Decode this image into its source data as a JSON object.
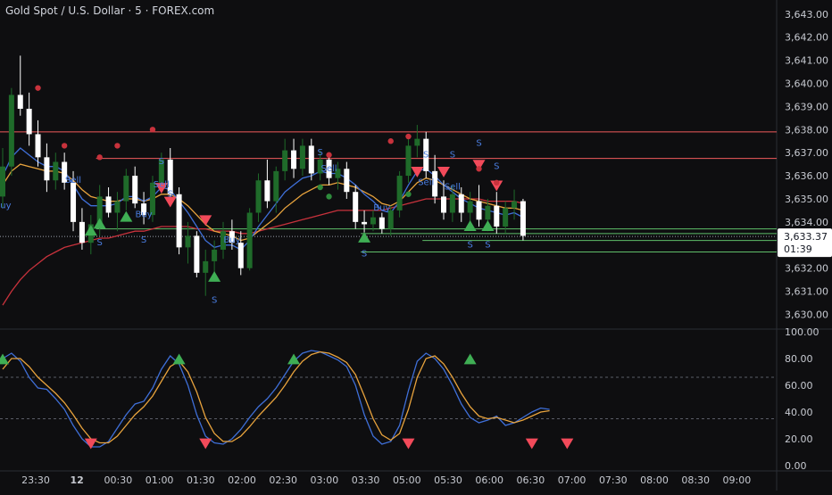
{
  "header": {
    "title": "Gold Spot / U.S. Dollar · 5 · FOREX.com"
  },
  "colors": {
    "background": "#0e0e10",
    "bull": "#1f6b2a",
    "bear": "#ffffff",
    "ma_slow": "#c8323c",
    "ma_fast": "#e8a33d",
    "ma_blue": "#3f6fd8",
    "level_red": "#f15b5b",
    "level_green": "#5fbf6a",
    "signal_buy": "#3fae54",
    "signal_sell": "#f24a5a",
    "stoch_k": "#3f6fd8",
    "stoch_d": "#e8a33d"
  },
  "price_axis": {
    "labels": [
      "3,643.00",
      "3,642.00",
      "3,641.00",
      "3,640.00",
      "3,639.00",
      "3,638.00",
      "3,637.00",
      "3,636.00",
      "3,635.00",
      "3,634.00",
      "3,632.00",
      "3,631.00",
      "3,630.00"
    ],
    "current_price": "3,633.37",
    "countdown": "01:39"
  },
  "time_axis": {
    "labels": [
      "23:30",
      "12",
      "00:30",
      "01:00",
      "01:30",
      "02:00",
      "02:30",
      "03:00",
      "03:30",
      "05:00",
      "05:30",
      "06:00",
      "06:30",
      "07:00",
      "07:30",
      "08:00",
      "08:30",
      "09:00"
    ]
  },
  "chart_data": [
    {
      "type": "candlestick",
      "title": "Gold Spot / U.S. Dollar · 5 · FOREX.com",
      "ylim": [
        3629.4,
        3643.3
      ],
      "current_price": 3633.37,
      "candles": [
        [
          3635.1,
          3637.2,
          3634.6,
          3636.4
        ],
        [
          3636.4,
          3639.8,
          3636.0,
          3639.5
        ],
        [
          3639.5,
          3641.2,
          3638.6,
          3638.9
        ],
        [
          3638.9,
          3639.6,
          3637.3,
          3637.8
        ],
        [
          3637.8,
          3638.4,
          3636.4,
          3636.8
        ],
        [
          3636.8,
          3637.4,
          3635.3,
          3635.8
        ],
        [
          3635.8,
          3637.0,
          3635.4,
          3636.6
        ],
        [
          3636.6,
          3637.0,
          3635.4,
          3635.7
        ],
        [
          3635.7,
          3636.2,
          3633.6,
          3634.0
        ],
        [
          3634.0,
          3634.6,
          3632.8,
          3633.1
        ],
        [
          3633.1,
          3634.3,
          3632.6,
          3633.9
        ],
        [
          3633.9,
          3635.6,
          3633.4,
          3635.1
        ],
        [
          3635.1,
          3635.5,
          3634.2,
          3634.4
        ],
        [
          3634.4,
          3635.3,
          3633.6,
          3634.9
        ],
        [
          3634.9,
          3636.3,
          3634.5,
          3636.0
        ],
        [
          3636.0,
          3636.4,
          3634.6,
          3634.8
        ],
        [
          3634.8,
          3635.3,
          3633.9,
          3634.3
        ],
        [
          3634.3,
          3636.0,
          3634.0,
          3635.7
        ],
        [
          3635.7,
          3637.0,
          3635.3,
          3636.7
        ],
        [
          3636.7,
          3637.2,
          3634.9,
          3635.2
        ],
        [
          3635.2,
          3635.5,
          3632.6,
          3632.9
        ],
        [
          3632.9,
          3634.0,
          3632.2,
          3633.4
        ],
        [
          3633.4,
          3633.6,
          3631.6,
          3631.8
        ],
        [
          3631.8,
          3632.8,
          3630.8,
          3632.3
        ],
        [
          3632.3,
          3633.2,
          3631.7,
          3632.8
        ],
        [
          3632.8,
          3634.0,
          3632.4,
          3633.6
        ],
        [
          3633.6,
          3634.1,
          3632.8,
          3633.1
        ],
        [
          3633.1,
          3633.6,
          3631.7,
          3632.0
        ],
        [
          3632.0,
          3634.6,
          3631.9,
          3634.4
        ],
        [
          3634.4,
          3636.1,
          3634.0,
          3635.8
        ],
        [
          3635.8,
          3636.7,
          3634.6,
          3634.9
        ],
        [
          3634.9,
          3636.4,
          3634.4,
          3636.2
        ],
        [
          3636.2,
          3637.6,
          3635.8,
          3637.1
        ],
        [
          3637.1,
          3637.6,
          3635.9,
          3636.3
        ],
        [
          3636.3,
          3637.6,
          3636.0,
          3637.3
        ],
        [
          3637.3,
          3637.6,
          3635.8,
          3636.1
        ],
        [
          3636.1,
          3637.1,
          3635.8,
          3636.7
        ],
        [
          3636.7,
          3636.9,
          3635.6,
          3635.9
        ],
        [
          3635.9,
          3636.6,
          3635.4,
          3636.3
        ],
        [
          3636.3,
          3636.6,
          3635.0,
          3635.3
        ],
        [
          3635.3,
          3635.6,
          3633.7,
          3634.0
        ],
        [
          3634.0,
          3634.5,
          3633.3,
          3633.9
        ],
        [
          3633.9,
          3634.5,
          3633.6,
          3634.2
        ],
        [
          3634.2,
          3634.4,
          3633.5,
          3633.7
        ],
        [
          3633.7,
          3634.7,
          3633.4,
          3634.5
        ],
        [
          3634.5,
          3636.2,
          3634.2,
          3636.0
        ],
        [
          3636.0,
          3637.6,
          3635.7,
          3637.3
        ],
        [
          3637.3,
          3638.2,
          3636.8,
          3637.6
        ],
        [
          3637.6,
          3637.9,
          3635.9,
          3636.2
        ],
        [
          3636.2,
          3636.9,
          3634.8,
          3635.1
        ],
        [
          3635.1,
          3635.8,
          3634.1,
          3634.4
        ],
        [
          3634.4,
          3635.6,
          3634.0,
          3635.2
        ],
        [
          3635.2,
          3635.5,
          3634.0,
          3634.4
        ],
        [
          3634.4,
          3635.3,
          3634.0,
          3634.9
        ],
        [
          3634.9,
          3635.6,
          3633.8,
          3634.1
        ],
        [
          3634.1,
          3635.0,
          3633.6,
          3634.7
        ],
        [
          3634.7,
          3635.3,
          3633.5,
          3633.8
        ],
        [
          3633.8,
          3634.9,
          3633.5,
          3634.6
        ],
        [
          3634.6,
          3635.4,
          3634.1,
          3634.9
        ],
        [
          3634.9,
          3635.0,
          3633.2,
          3633.4
        ]
      ],
      "moving_averages": [
        {
          "name": "",
          "color": "#c8323c",
          "values": [
            3630.4,
            3631.0,
            3631.5,
            3631.9,
            3632.2,
            3632.5,
            3632.7,
            3632.9,
            3633.0,
            3633.1,
            3633.2,
            3633.3,
            3633.3,
            3633.4,
            3633.5,
            3633.6,
            3633.6,
            3633.7,
            3633.8,
            3633.8,
            3633.8,
            3633.8,
            3633.7,
            3633.7,
            3633.6,
            3633.6,
            3633.6,
            3633.5,
            3633.5,
            3633.6,
            3633.7,
            3633.8,
            3633.9,
            3634.0,
            3634.1,
            3634.2,
            3634.3,
            3634.4,
            3634.5,
            3634.5,
            3634.5,
            3634.5,
            3634.5,
            3634.5,
            3634.6,
            3634.7,
            3634.8,
            3634.9,
            3635.0,
            3635.0,
            3635.0,
            3635.0,
            3635.0,
            3635.0,
            3635.0,
            3634.9,
            3634.9,
            3634.9,
            3634.9,
            3634.8
          ]
        },
        {
          "name": "",
          "color": "#e8a33d",
          "values": [
            3635.6,
            3636.2,
            3636.5,
            3636.4,
            3636.3,
            3636.2,
            3636.2,
            3636.1,
            3635.8,
            3635.4,
            3635.1,
            3635.0,
            3634.9,
            3634.9,
            3635.0,
            3635.0,
            3634.9,
            3635.0,
            3635.2,
            3635.2,
            3635.0,
            3634.7,
            3634.3,
            3633.9,
            3633.6,
            3633.5,
            3633.4,
            3633.2,
            3633.3,
            3633.6,
            3633.9,
            3634.2,
            3634.6,
            3634.9,
            3635.2,
            3635.4,
            3635.6,
            3635.6,
            3635.7,
            3635.6,
            3635.5,
            3635.3,
            3635.1,
            3634.8,
            3634.7,
            3634.9,
            3635.3,
            3635.7,
            3635.9,
            3635.8,
            3635.6,
            3635.4,
            3635.2,
            3635.0,
            3634.9,
            3634.8,
            3634.7,
            3634.6,
            3634.6,
            3634.5
          ]
        },
        {
          "name": "",
          "color": "#3f6fd8",
          "values": [
            3636.0,
            3636.8,
            3637.2,
            3636.9,
            3636.6,
            3636.4,
            3636.4,
            3636.2,
            3635.6,
            3635.0,
            3634.7,
            3634.7,
            3634.7,
            3634.8,
            3635.1,
            3635.1,
            3634.9,
            3635.1,
            3635.5,
            3635.4,
            3634.9,
            3634.4,
            3633.8,
            3633.2,
            3632.9,
            3633.0,
            3633.0,
            3632.8,
            3633.2,
            3633.8,
            3634.3,
            3634.8,
            3635.3,
            3635.6,
            3635.9,
            3636.0,
            3636.2,
            3636.1,
            3636.1,
            3635.9,
            3635.6,
            3635.2,
            3634.9,
            3634.5,
            3634.4,
            3634.9,
            3635.6,
            3636.2,
            3636.3,
            3636.0,
            3635.6,
            3635.3,
            3635.0,
            3634.8,
            3634.6,
            3634.5,
            3634.4,
            3634.3,
            3634.4,
            3634.2
          ]
        }
      ],
      "levels": [
        {
          "price": 3637.9,
          "color": "#f15b5b",
          "from_index": 0
        },
        {
          "price": 3636.75,
          "color": "#f15b5b",
          "from_index": 11
        },
        {
          "price": 3633.7,
          "color": "#5fbf6a",
          "from_index": 11
        },
        {
          "price": 3633.5,
          "color": "#5fbf6a",
          "from_index": 41
        },
        {
          "price": 3633.2,
          "color": "#5fbf6a",
          "from_index": 48
        },
        {
          "price": 3632.7,
          "color": "#5fbf6a",
          "from_index": 41
        }
      ],
      "signals": [
        {
          "kind": "buy-triangle",
          "index": 10,
          "price": 3633.6
        },
        {
          "kind": "buy-triangle",
          "index": 11,
          "price": 3633.9
        },
        {
          "kind": "buy-triangle",
          "index": 14,
          "price": 3634.2
        },
        {
          "kind": "buy-triangle",
          "index": 24,
          "price": 3631.6
        },
        {
          "kind": "buy-triangle",
          "index": 41,
          "price": 3633.3
        },
        {
          "kind": "buy-triangle",
          "index": 53,
          "price": 3633.8
        },
        {
          "kind": "buy-triangle",
          "index": 55,
          "price": 3633.8
        },
        {
          "kind": "sell-triangle",
          "index": 18,
          "price": 3635.5
        },
        {
          "kind": "sell-triangle",
          "index": 19,
          "price": 3634.9
        },
        {
          "kind": "sell-triangle",
          "index": 23,
          "price": 3634.1
        },
        {
          "kind": "sell-triangle",
          "index": 47,
          "price": 3636.2
        },
        {
          "kind": "sell-triangle",
          "index": 50,
          "price": 3636.2
        },
        {
          "kind": "sell-triangle",
          "index": 54,
          "price": 3636.5
        },
        {
          "kind": "sell-triangle",
          "index": 56,
          "price": 3635.6
        },
        {
          "kind": "red-dot",
          "index": 4,
          "price": 3639.8
        },
        {
          "kind": "red-dot",
          "index": 7,
          "price": 3637.3
        },
        {
          "kind": "red-dot",
          "index": 11,
          "price": 3636.8
        },
        {
          "kind": "red-dot",
          "index": 13,
          "price": 3637.3
        },
        {
          "kind": "red-dot",
          "index": 17,
          "price": 3638.0
        },
        {
          "kind": "red-dot",
          "index": 37,
          "price": 3636.9
        },
        {
          "kind": "red-dot",
          "index": 44,
          "price": 3637.5
        },
        {
          "kind": "red-dot",
          "index": 46,
          "price": 3637.7
        },
        {
          "kind": "red-dot",
          "index": 54,
          "price": 3636.3
        },
        {
          "kind": "red-dot",
          "index": 56,
          "price": 3635.7
        },
        {
          "kind": "green-dot",
          "index": 36,
          "price": 3635.5
        },
        {
          "kind": "green-dot",
          "index": 37,
          "price": 3635.1
        },
        {
          "kind": "green-dot",
          "index": 46,
          "price": 3635.2
        }
      ],
      "labels": [
        {
          "text": "S",
          "index": 11,
          "price": 3633.0
        },
        {
          "text": "S",
          "index": 16,
          "price": 3633.1
        },
        {
          "text": "S",
          "index": 24,
          "price": 3630.5
        },
        {
          "text": "S",
          "index": 18,
          "price": 3636.5
        },
        {
          "text": "S",
          "index": 19,
          "price": 3635.1
        },
        {
          "text": "S",
          "index": 36,
          "price": 3636.9
        },
        {
          "text": "S",
          "index": 41,
          "price": 3632.5
        },
        {
          "text": "S",
          "index": 48,
          "price": 3636.8
        },
        {
          "text": "S",
          "index": 51,
          "price": 3636.8
        },
        {
          "text": "S",
          "index": 54,
          "price": 3637.3
        },
        {
          "text": "S",
          "index": 56,
          "price": 3636.3
        },
        {
          "text": "S",
          "index": 53,
          "price": 3632.9
        },
        {
          "text": "S",
          "index": 55,
          "price": 3632.9
        },
        {
          "text": "Buy",
          "index": 0,
          "price": 3634.6
        },
        {
          "text": "Buy",
          "index": 16,
          "price": 3634.2
        },
        {
          "text": "Buy",
          "index": 26,
          "price": 3633.1
        },
        {
          "text": "Buy",
          "index": 43,
          "price": 3634.5
        },
        {
          "text": "Sell",
          "index": 8,
          "price": 3635.7
        },
        {
          "text": "Sell",
          "index": 18,
          "price": 3635.5
        },
        {
          "text": "Sell",
          "index": 37,
          "price": 3636.2
        },
        {
          "text": "Sell",
          "index": 48,
          "price": 3635.6
        },
        {
          "text": "Sell",
          "index": 51,
          "price": 3635.4
        }
      ]
    },
    {
      "type": "line",
      "ylim": [
        0,
        100
      ],
      "yticks": [
        "100.00",
        "80.00",
        "60.00",
        "40.00",
        "20.00",
        "0.00"
      ],
      "reference_lines": [
        66,
        35
      ],
      "series": [
        {
          "name": "",
          "color": "#3f6fd8",
          "values": [
            80,
            84,
            78,
            66,
            58,
            57,
            50,
            42,
            30,
            20,
            14,
            14,
            18,
            28,
            38,
            46,
            48,
            58,
            72,
            82,
            76,
            60,
            38,
            22,
            17,
            16,
            20,
            27,
            36,
            44,
            50,
            58,
            68,
            78,
            84,
            86,
            85,
            82,
            79,
            74,
            60,
            38,
            22,
            16,
            18,
            30,
            56,
            78,
            84,
            80,
            72,
            60,
            46,
            36,
            32,
            34,
            37,
            30,
            32,
            36,
            40,
            43,
            42
          ]
        },
        {
          "name": "",
          "color": "#e8a33d",
          "values": [
            72,
            80,
            80,
            74,
            66,
            60,
            54,
            47,
            38,
            28,
            20,
            17,
            17,
            22,
            30,
            38,
            44,
            52,
            63,
            74,
            78,
            70,
            55,
            36,
            24,
            18,
            18,
            22,
            29,
            37,
            44,
            51,
            60,
            70,
            78,
            83,
            85,
            84,
            81,
            77,
            68,
            52,
            35,
            23,
            19,
            24,
            42,
            66,
            80,
            82,
            76,
            66,
            54,
            44,
            37,
            35,
            36,
            34,
            32,
            34,
            37,
            40,
            41
          ]
        }
      ],
      "signals": [
        {
          "kind": "buy-triangle",
          "index": 0,
          "value": 79
        },
        {
          "kind": "buy-triangle",
          "index": 20,
          "value": 79
        },
        {
          "kind": "buy-triangle",
          "index": 33,
          "value": 79
        },
        {
          "kind": "buy-triangle",
          "index": 53,
          "value": 79
        },
        {
          "kind": "sell-triangle",
          "index": 10,
          "value": 17
        },
        {
          "kind": "sell-triangle",
          "index": 23,
          "value": 17
        },
        {
          "kind": "sell-triangle",
          "index": 46,
          "value": 17
        },
        {
          "kind": "sell-triangle",
          "index": 60,
          "value": 17
        },
        {
          "kind": "sell-triangle",
          "index": 64,
          "value": 17
        }
      ]
    }
  ]
}
